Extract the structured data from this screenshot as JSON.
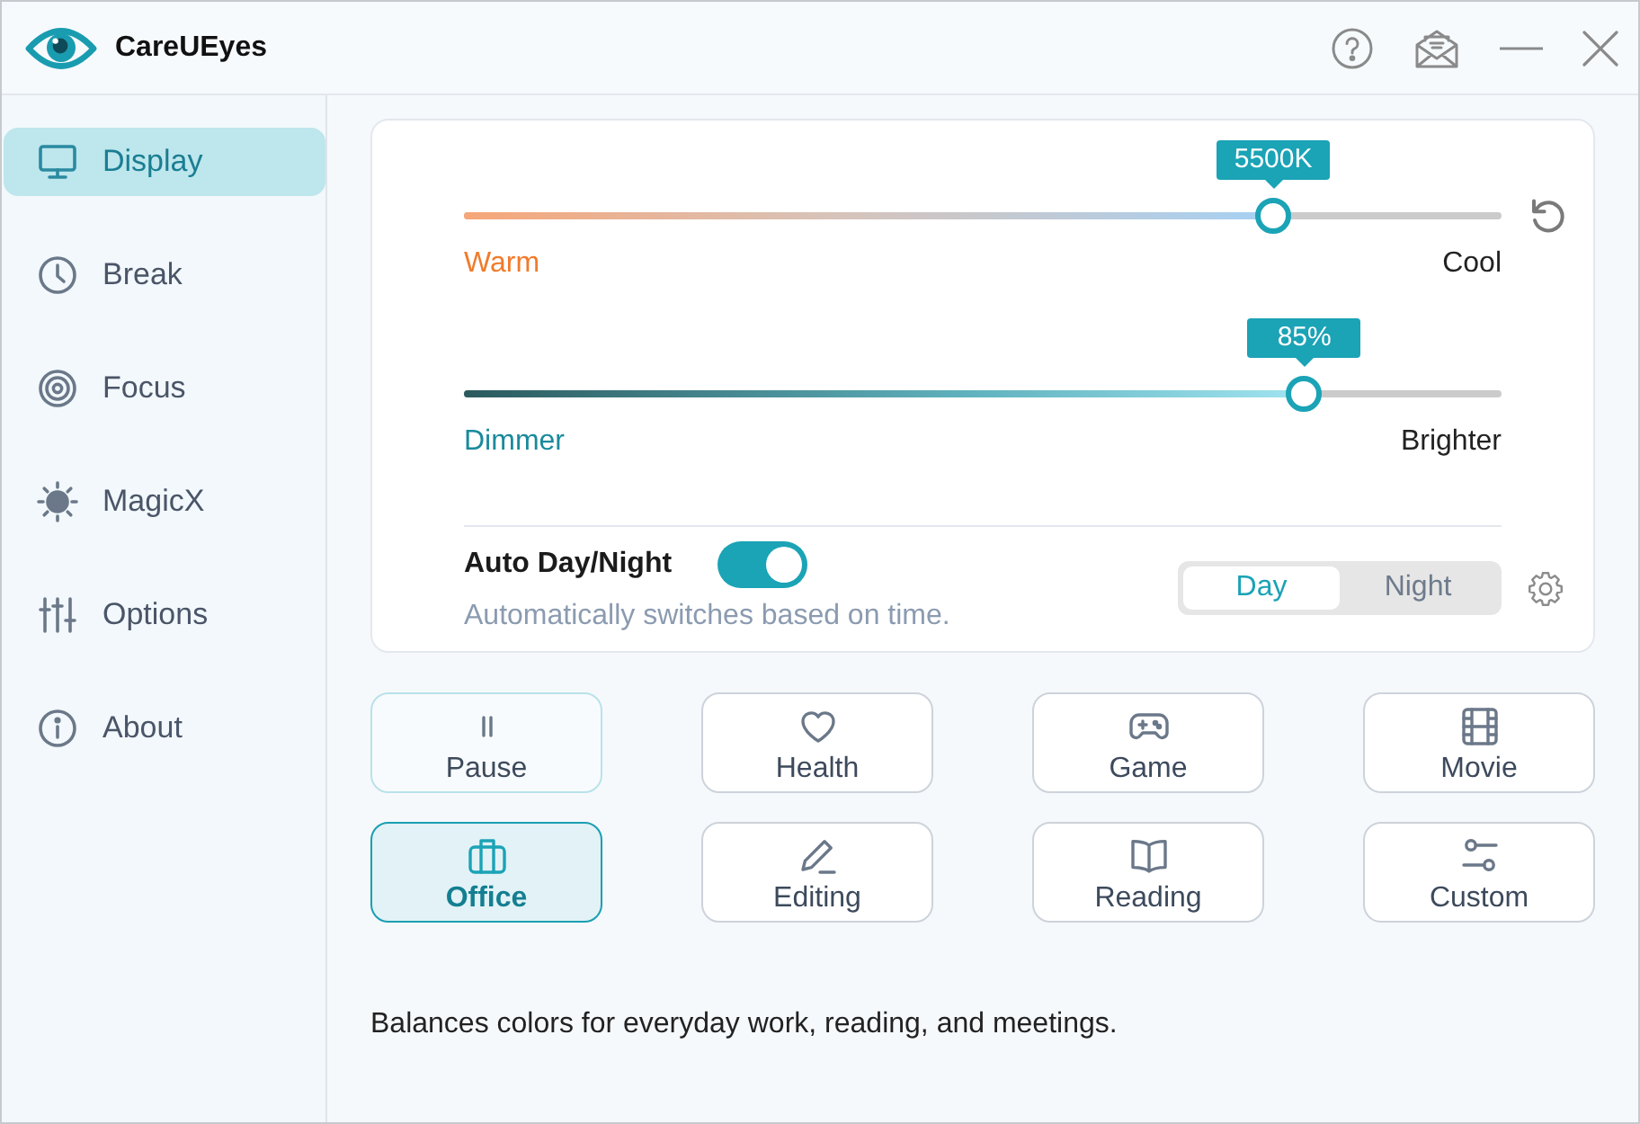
{
  "window": {
    "title": "CareUEyes"
  },
  "sidebar": {
    "items": [
      {
        "label": "Display",
        "selected": true
      },
      {
        "label": "Break",
        "selected": false
      },
      {
        "label": "Focus",
        "selected": false
      },
      {
        "label": "MagicX",
        "selected": false
      },
      {
        "label": "Options",
        "selected": false
      },
      {
        "label": "About",
        "selected": false
      }
    ]
  },
  "display": {
    "color_temperature": {
      "reading": "5500K",
      "level": 0.78,
      "min_label": "Warm",
      "max_label": "Cool"
    },
    "brightness": {
      "reading": "85%",
      "level": 0.81,
      "min_label": "Dimmer",
      "max_label": "Brighter"
    },
    "auto_day_night": {
      "label": "Auto Day/Night",
      "on": true,
      "description": "Automatically switches based on time.",
      "modes": [
        {
          "label": "Day",
          "selected": true
        },
        {
          "label": "Night",
          "selected": false
        }
      ]
    }
  },
  "presets": [
    {
      "label": "Pause",
      "kind": "action",
      "selected": false
    },
    {
      "label": "Health",
      "kind": "preset",
      "selected": false
    },
    {
      "label": "Game",
      "kind": "preset",
      "selected": false
    },
    {
      "label": "Movie",
      "kind": "preset",
      "selected": false
    },
    {
      "label": "Office",
      "kind": "preset",
      "selected": true
    },
    {
      "label": "Editing",
      "kind": "preset",
      "selected": false
    },
    {
      "label": "Reading",
      "kind": "preset",
      "selected": false
    },
    {
      "label": "Custom",
      "kind": "preset",
      "selected": false
    }
  ],
  "description": "Balances colors for everyday work, reading, and meetings."
}
